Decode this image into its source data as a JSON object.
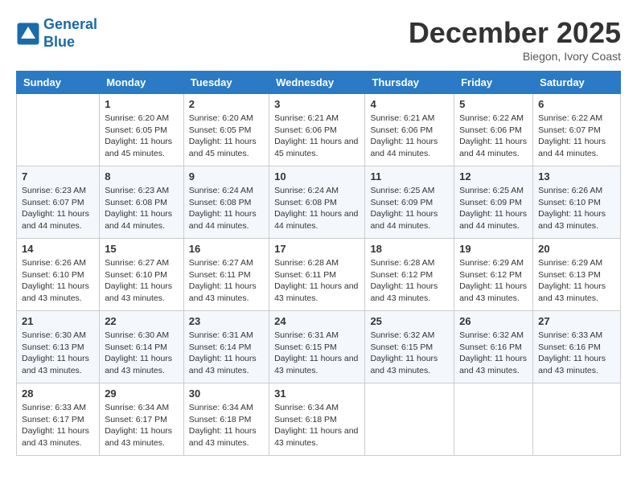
{
  "header": {
    "logo_line1": "General",
    "logo_line2": "Blue",
    "month_title": "December 2025",
    "location": "Biegon, Ivory Coast"
  },
  "days_of_week": [
    "Sunday",
    "Monday",
    "Tuesday",
    "Wednesday",
    "Thursday",
    "Friday",
    "Saturday"
  ],
  "weeks": [
    [
      {
        "day": "",
        "info": ""
      },
      {
        "day": "1",
        "info": "Sunrise: 6:20 AM\nSunset: 6:05 PM\nDaylight: 11 hours and 45 minutes."
      },
      {
        "day": "2",
        "info": "Sunrise: 6:20 AM\nSunset: 6:05 PM\nDaylight: 11 hours and 45 minutes."
      },
      {
        "day": "3",
        "info": "Sunrise: 6:21 AM\nSunset: 6:06 PM\nDaylight: 11 hours and 45 minutes."
      },
      {
        "day": "4",
        "info": "Sunrise: 6:21 AM\nSunset: 6:06 PM\nDaylight: 11 hours and 44 minutes."
      },
      {
        "day": "5",
        "info": "Sunrise: 6:22 AM\nSunset: 6:06 PM\nDaylight: 11 hours and 44 minutes."
      },
      {
        "day": "6",
        "info": "Sunrise: 6:22 AM\nSunset: 6:07 PM\nDaylight: 11 hours and 44 minutes."
      }
    ],
    [
      {
        "day": "7",
        "info": "Sunrise: 6:23 AM\nSunset: 6:07 PM\nDaylight: 11 hours and 44 minutes."
      },
      {
        "day": "8",
        "info": "Sunrise: 6:23 AM\nSunset: 6:08 PM\nDaylight: 11 hours and 44 minutes."
      },
      {
        "day": "9",
        "info": "Sunrise: 6:24 AM\nSunset: 6:08 PM\nDaylight: 11 hours and 44 minutes."
      },
      {
        "day": "10",
        "info": "Sunrise: 6:24 AM\nSunset: 6:08 PM\nDaylight: 11 hours and 44 minutes."
      },
      {
        "day": "11",
        "info": "Sunrise: 6:25 AM\nSunset: 6:09 PM\nDaylight: 11 hours and 44 minutes."
      },
      {
        "day": "12",
        "info": "Sunrise: 6:25 AM\nSunset: 6:09 PM\nDaylight: 11 hours and 44 minutes."
      },
      {
        "day": "13",
        "info": "Sunrise: 6:26 AM\nSunset: 6:10 PM\nDaylight: 11 hours and 43 minutes."
      }
    ],
    [
      {
        "day": "14",
        "info": "Sunrise: 6:26 AM\nSunset: 6:10 PM\nDaylight: 11 hours and 43 minutes."
      },
      {
        "day": "15",
        "info": "Sunrise: 6:27 AM\nSunset: 6:10 PM\nDaylight: 11 hours and 43 minutes."
      },
      {
        "day": "16",
        "info": "Sunrise: 6:27 AM\nSunset: 6:11 PM\nDaylight: 11 hours and 43 minutes."
      },
      {
        "day": "17",
        "info": "Sunrise: 6:28 AM\nSunset: 6:11 PM\nDaylight: 11 hours and 43 minutes."
      },
      {
        "day": "18",
        "info": "Sunrise: 6:28 AM\nSunset: 6:12 PM\nDaylight: 11 hours and 43 minutes."
      },
      {
        "day": "19",
        "info": "Sunrise: 6:29 AM\nSunset: 6:12 PM\nDaylight: 11 hours and 43 minutes."
      },
      {
        "day": "20",
        "info": "Sunrise: 6:29 AM\nSunset: 6:13 PM\nDaylight: 11 hours and 43 minutes."
      }
    ],
    [
      {
        "day": "21",
        "info": "Sunrise: 6:30 AM\nSunset: 6:13 PM\nDaylight: 11 hours and 43 minutes."
      },
      {
        "day": "22",
        "info": "Sunrise: 6:30 AM\nSunset: 6:14 PM\nDaylight: 11 hours and 43 minutes."
      },
      {
        "day": "23",
        "info": "Sunrise: 6:31 AM\nSunset: 6:14 PM\nDaylight: 11 hours and 43 minutes."
      },
      {
        "day": "24",
        "info": "Sunrise: 6:31 AM\nSunset: 6:15 PM\nDaylight: 11 hours and 43 minutes."
      },
      {
        "day": "25",
        "info": "Sunrise: 6:32 AM\nSunset: 6:15 PM\nDaylight: 11 hours and 43 minutes."
      },
      {
        "day": "26",
        "info": "Sunrise: 6:32 AM\nSunset: 6:16 PM\nDaylight: 11 hours and 43 minutes."
      },
      {
        "day": "27",
        "info": "Sunrise: 6:33 AM\nSunset: 6:16 PM\nDaylight: 11 hours and 43 minutes."
      }
    ],
    [
      {
        "day": "28",
        "info": "Sunrise: 6:33 AM\nSunset: 6:17 PM\nDaylight: 11 hours and 43 minutes."
      },
      {
        "day": "29",
        "info": "Sunrise: 6:34 AM\nSunset: 6:17 PM\nDaylight: 11 hours and 43 minutes."
      },
      {
        "day": "30",
        "info": "Sunrise: 6:34 AM\nSunset: 6:18 PM\nDaylight: 11 hours and 43 minutes."
      },
      {
        "day": "31",
        "info": "Sunrise: 6:34 AM\nSunset: 6:18 PM\nDaylight: 11 hours and 43 minutes."
      },
      {
        "day": "",
        "info": ""
      },
      {
        "day": "",
        "info": ""
      },
      {
        "day": "",
        "info": ""
      }
    ]
  ]
}
